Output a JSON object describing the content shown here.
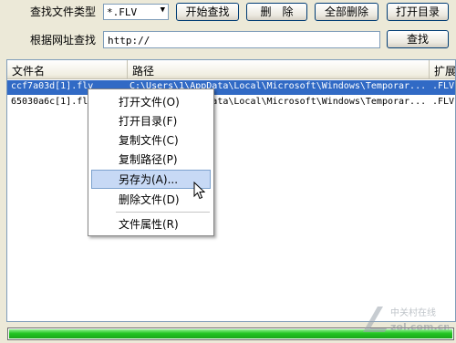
{
  "search": {
    "file_type_label": "查找文件类型",
    "file_type_value": "*.FLV",
    "url_label": "根据网址查找",
    "url_value": "http://"
  },
  "buttons": {
    "start_search": "开始查找",
    "delete": "删　除",
    "delete_all": "全部删除",
    "open_dir": "打开目录",
    "search": "查找"
  },
  "table": {
    "columns": [
      "文件名",
      "路径",
      "扩展名"
    ],
    "rows": [
      {
        "name": "ccf7a03d[1].flv",
        "path": "C:\\Users\\1\\AppData\\Local\\Microsoft\\Windows\\Temporar...",
        "ext": ".FLV",
        "selected": true
      },
      {
        "name": "65030a6c[1].flv",
        "path": "C:\\Users\\1\\AppData\\Local\\Microsoft\\Windows\\Temporar...",
        "ext": ".FLV",
        "selected": false
      }
    ]
  },
  "context_menu": {
    "items": [
      "打开文件(O)",
      "打开目录(F)",
      "复制文件(C)",
      "复制路径(P)",
      "另存为(A)...",
      "删除文件(D)",
      "文件属性(R)"
    ],
    "highlighted": "另存为(A)..."
  },
  "progress": {
    "value": 1.0
  },
  "watermark": {
    "name": "中关村在线",
    "domain": "zol.com.cn"
  },
  "colors": {
    "selection": "#316ac5",
    "progress": "#22c522",
    "menu_highlight": "#c7d9f5"
  }
}
